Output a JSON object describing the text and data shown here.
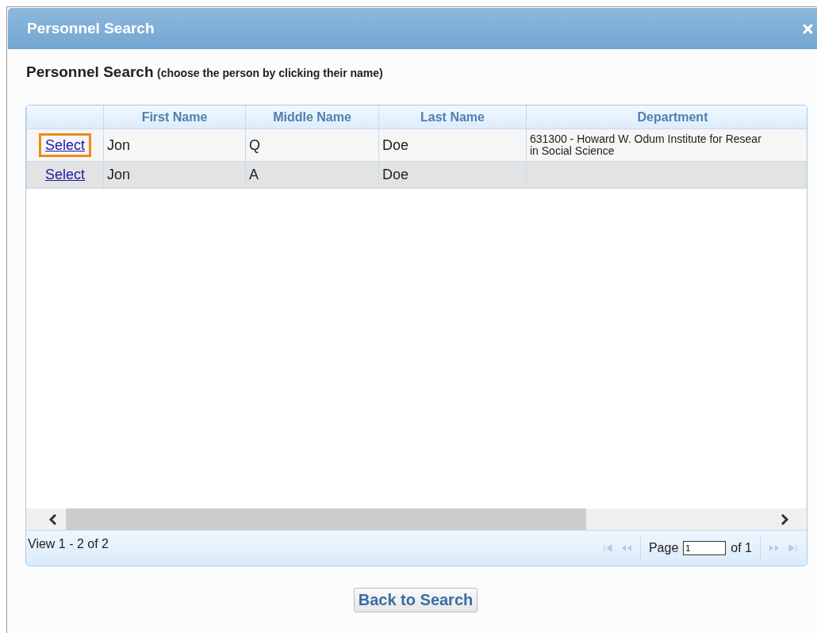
{
  "window": {
    "title": "Personnel Search"
  },
  "heading": {
    "title": "Personnel Search",
    "hint": "(choose the person by clicking their name)"
  },
  "table": {
    "columns": [
      "First Name",
      "Middle Name",
      "Last Name",
      "Department"
    ],
    "rows": [
      {
        "link": "Select",
        "outlined": true,
        "hover": false,
        "cells": [
          "Jon",
          "Q",
          "Doe",
          "631300 - Howard W. Odum Institute for Resear\nin Social Science"
        ]
      },
      {
        "link": "Select",
        "outlined": false,
        "hover": true,
        "cells": [
          "Jon",
          "A",
          "Doe",
          ""
        ]
      }
    ]
  },
  "pager": {
    "summary": "View 1 - 2 of 2",
    "page_label": "Page",
    "page_value": "1",
    "of_label": "of 1"
  },
  "buttons": [
    "Back to Search"
  ]
}
